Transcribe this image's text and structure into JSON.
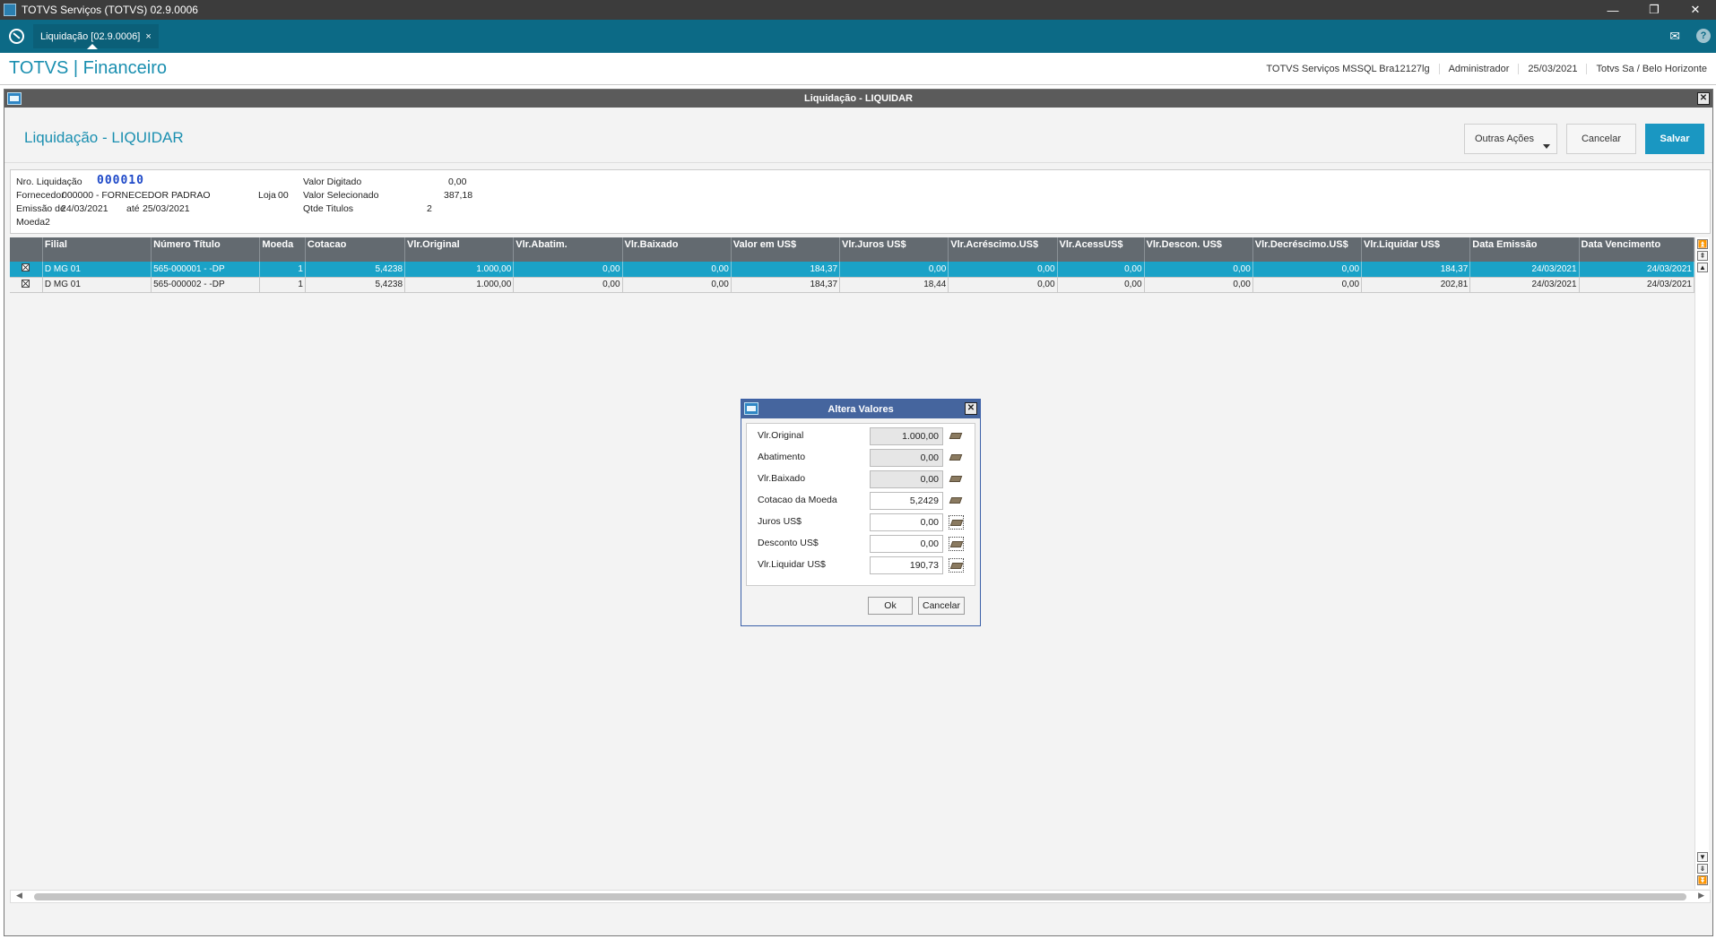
{
  "window": {
    "title": "TOTVS Serviços (TOTVS) 02.9.0006",
    "controls": [
      "—",
      "❐",
      "✕"
    ]
  },
  "tabbar": {
    "tab_label": "Liquidação [02.9.0006]",
    "tab_close": "×",
    "mail_icon": "✉",
    "help_icon": "?"
  },
  "header": {
    "brand": "TOTVS | Financeiro",
    "env": "TOTVS Serviços MSSQL Bra12127lg",
    "user": "Administrador",
    "date": "25/03/2021",
    "company": "Totvs Sa / Belo Horizonte"
  },
  "routine": {
    "window_title": "Liquidação - LIQUIDAR",
    "page_title": "Liquidação - LIQUIDAR",
    "buttons": {
      "outras": "Outras Ações",
      "cancelar": "Cancelar",
      "salvar": "Salvar"
    }
  },
  "info": {
    "nro_label": "Nro. Liquidação",
    "nro_value": "000010",
    "fornecedor_label": "Fornecedor",
    "fornecedor_value": "000000 - FORNECEDOR PADRAO",
    "loja_label": "Loja",
    "loja_value": "00",
    "emissao_label": "Emissão de",
    "emissao_de": "24/03/2021",
    "ate_label": "até",
    "emissao_ate": "25/03/2021",
    "moeda_label": "Moeda",
    "moeda_value": "2",
    "valor_digitado_label": "Valor Digitado",
    "valor_digitado": "0,00",
    "valor_selecionado_label": "Valor Selecionado",
    "valor_selecionado": "387,18",
    "qtde_label": "Qtde Titulos",
    "qtde_value": "2"
  },
  "grid": {
    "columns": [
      "",
      "Filial",
      "Número Título",
      "Moeda",
      "Cotacao",
      "Vlr.Original",
      "Vlr.Abatim.",
      "Vlr.Baixado",
      "Valor em US$",
      "Vlr.Juros US$",
      "Vlr.Acréscimo.US$",
      "Vlr.AcessUS$",
      "Vlr.Descon. US$",
      "Vlr.Decréscimo.US$",
      "Vlr.Liquidar US$",
      "Data Emissão",
      "Data Vencimento"
    ],
    "rows": [
      [
        "",
        "D MG 01",
        "565-000001   -  -DP",
        "1",
        "5,4238",
        "1.000,00",
        "0,00",
        "0,00",
        "184,37",
        "0,00",
        "0,00",
        "0,00",
        "0,00",
        "0,00",
        "184,37",
        "24/03/2021",
        "24/03/2021"
      ],
      [
        "",
        "D MG 01",
        "565-000002   -  -DP",
        "1",
        "5,4238",
        "1.000,00",
        "0,00",
        "0,00",
        "184,37",
        "18,44",
        "0,00",
        "0,00",
        "0,00",
        "0,00",
        "202,81",
        "24/03/2021",
        "24/03/2021"
      ]
    ]
  },
  "dialog": {
    "title": "Altera Valores",
    "fields": [
      {
        "label": "Vlr.Original",
        "value": "1.000,00",
        "readonly": true
      },
      {
        "label": "Abatimento",
        "value": "0,00",
        "readonly": true
      },
      {
        "label": "Vlr.Baixado",
        "value": "0,00",
        "readonly": true
      },
      {
        "label": "Cotacao da Moeda",
        "value": "5,2429",
        "readonly": false
      },
      {
        "label": "Juros US$",
        "value": "0,00",
        "readonly": false
      },
      {
        "label": "Desconto US$",
        "value": "0,00",
        "readonly": false
      },
      {
        "label": "Vlr.Liquidar US$",
        "value": "190,73",
        "readonly": false
      }
    ],
    "ok": "Ok",
    "cancel": "Cancelar"
  }
}
